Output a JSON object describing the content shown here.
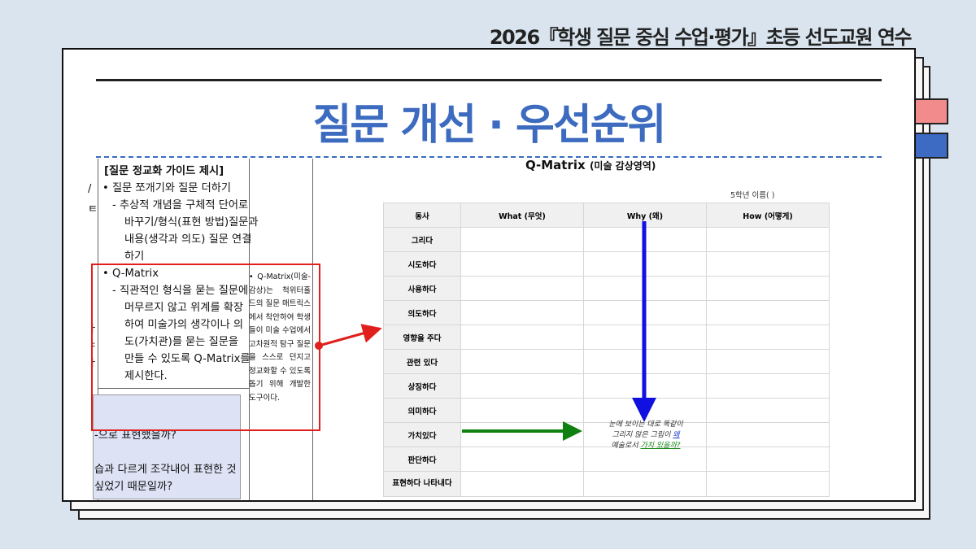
{
  "header": {
    "event_title": "2026『학생 질문 중심 수업·평가』초등 선도교원 연수"
  },
  "slide": {
    "title": "질문 개선 · 우선순위"
  },
  "doc": {
    "heading": "[질문 정교화 가이드 제시]",
    "bullet1": "• 질문 쪼개기와 질문 더하기",
    "sub1": [
      "- 추상적 개념을 구체적 단어로",
      "바꾸기/형식(표현 방법)질문과",
      "내용(생각과 의도) 질문 연결",
      "하기"
    ],
    "bullet2": "• Q-Matrix",
    "sub2": [
      "- 직관적인 형식을 묻는 질문에",
      "머무르지 않고 위계를 확장",
      "하여 미술가의 생각이나 의",
      "도(가치관)를 묻는 질문을",
      "만들 수 있도록 Q-Matrix를",
      "제시한다."
    ],
    "edge_chars": [
      "/",
      "ㅌ",
      "ㅏ",
      "ㅑ",
      "ㅏ"
    ],
    "note": "• Q-Matrix(미술-감상)는 척위터홀드의 질문 매트릭스에서 착안하여 학생들이 미술 수업에서 고차원적 탐구 질문을 스스로 던지고 정교화할 수 있도록 돕기 위해 개발한 도구이다.",
    "bottom_q1": "-으로 표현했을까?",
    "bottom_q2": "습과 다르게 조각내어 표현한 것",
    "bottom_q3": "싶었기 때문일까?"
  },
  "qmatrix": {
    "title": "Q-Matrix",
    "subtitle": "(미술 감상영역)",
    "name_line": "5학년 이름(                )",
    "headers": [
      "동사",
      "What (무엇)",
      "Why (왜)",
      "How (어떻게)"
    ],
    "verbs": [
      "그리다",
      "시도하다",
      "사용하다",
      "의도하다",
      "영향을 주다",
      "관련 있다",
      "상징하다",
      "의미하다",
      "가치있다",
      "판단하다",
      "표현하다 나타내다"
    ],
    "why_note": {
      "line1": "눈에 보이는 대로 똑같이",
      "line2a": "그리지 않은 그림이 ",
      "line2b": "왜",
      "line3a": "예술로서 ",
      "line3b": "가치 있을까?"
    }
  },
  "colors": {
    "title_blue": "#3c6bc0",
    "tab_red": "#f28c8c",
    "tab_blue": "#3d6bc4",
    "highlight_red": "#e0201c",
    "arrow_blue": "#1010e0",
    "arrow_green": "#108010"
  }
}
